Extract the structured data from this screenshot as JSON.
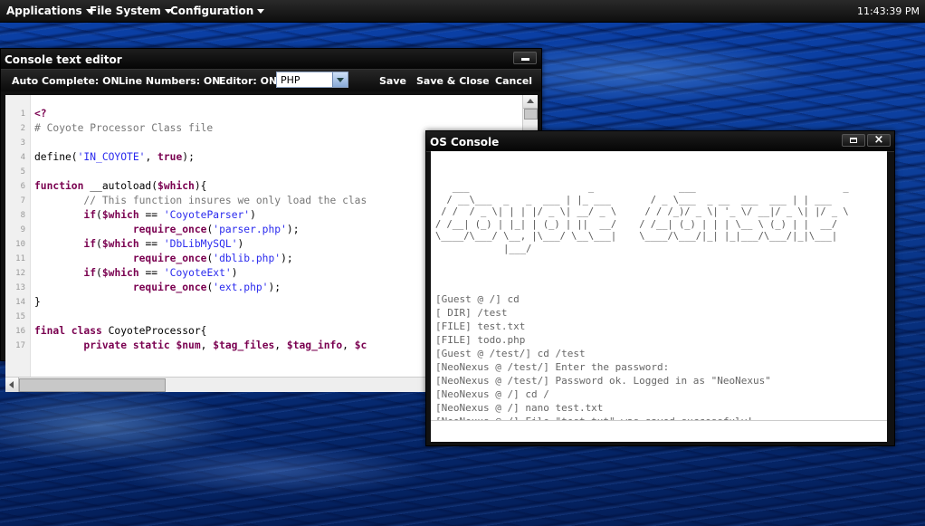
{
  "topbar": {
    "menus": [
      {
        "label": "Applications"
      },
      {
        "label": "File System"
      },
      {
        "label": "Configuration"
      }
    ],
    "clock": "11:43:39 PM"
  },
  "editor": {
    "title": "Console text editor",
    "auto_complete": "Auto Complete: ON",
    "line_numbers": "Line Numbers: ON",
    "editor_mode": "Editor: ON",
    "language": "PHP",
    "save": "Save",
    "save_close": "Save & Close",
    "cancel": "Cancel",
    "lines": [
      {
        "n": "1",
        "segs": [
          {
            "c": "kw",
            "t": "<?"
          }
        ]
      },
      {
        "n": "2",
        "segs": [
          {
            "c": "cm",
            "t": "# Coyote Processor Class file"
          }
        ]
      },
      {
        "n": "3",
        "segs": []
      },
      {
        "n": "4",
        "segs": [
          {
            "c": "fn",
            "t": "define("
          },
          {
            "c": "st",
            "t": "'IN_COYOTE'"
          },
          {
            "c": "fn",
            "t": ", "
          },
          {
            "c": "kw",
            "t": "true"
          },
          {
            "c": "fn",
            "t": ");"
          }
        ]
      },
      {
        "n": "5",
        "segs": []
      },
      {
        "n": "6",
        "segs": [
          {
            "c": "kw",
            "t": "function"
          },
          {
            "c": "fn",
            "t": " __autoload("
          },
          {
            "c": "vr",
            "t": "$which"
          },
          {
            "c": "fn",
            "t": "){"
          }
        ]
      },
      {
        "n": "7",
        "segs": [
          {
            "c": "cm",
            "t": "        // This function insures we only load the clas"
          }
        ]
      },
      {
        "n": "8",
        "segs": [
          {
            "c": "fn",
            "t": "        "
          },
          {
            "c": "kw",
            "t": "if"
          },
          {
            "c": "fn",
            "t": "("
          },
          {
            "c": "vr",
            "t": "$which"
          },
          {
            "c": "fn",
            "t": " == "
          },
          {
            "c": "st",
            "t": "'CoyoteParser'"
          },
          {
            "c": "fn",
            "t": ")"
          }
        ]
      },
      {
        "n": "9",
        "segs": [
          {
            "c": "fn",
            "t": "                "
          },
          {
            "c": "kw",
            "t": "require_once"
          },
          {
            "c": "fn",
            "t": "("
          },
          {
            "c": "st",
            "t": "'parser.php'"
          },
          {
            "c": "fn",
            "t": ");"
          }
        ]
      },
      {
        "n": "10",
        "segs": [
          {
            "c": "fn",
            "t": "        "
          },
          {
            "c": "kw",
            "t": "if"
          },
          {
            "c": "fn",
            "t": "("
          },
          {
            "c": "vr",
            "t": "$which"
          },
          {
            "c": "fn",
            "t": " == "
          },
          {
            "c": "st",
            "t": "'DbLibMySQL'"
          },
          {
            "c": "fn",
            "t": ")"
          }
        ]
      },
      {
        "n": "11",
        "segs": [
          {
            "c": "fn",
            "t": "                "
          },
          {
            "c": "kw",
            "t": "require_once"
          },
          {
            "c": "fn",
            "t": "("
          },
          {
            "c": "st",
            "t": "'dblib.php'"
          },
          {
            "c": "fn",
            "t": ");"
          }
        ]
      },
      {
        "n": "12",
        "segs": [
          {
            "c": "fn",
            "t": "        "
          },
          {
            "c": "kw",
            "t": "if"
          },
          {
            "c": "fn",
            "t": "("
          },
          {
            "c": "vr",
            "t": "$which"
          },
          {
            "c": "fn",
            "t": " == "
          },
          {
            "c": "st",
            "t": "'CoyoteExt'"
          },
          {
            "c": "fn",
            "t": ")"
          }
        ]
      },
      {
        "n": "13",
        "segs": [
          {
            "c": "fn",
            "t": "                "
          },
          {
            "c": "kw",
            "t": "require_once"
          },
          {
            "c": "fn",
            "t": "("
          },
          {
            "c": "st",
            "t": "'ext.php'"
          },
          {
            "c": "fn",
            "t": ");"
          }
        ]
      },
      {
        "n": "14",
        "segs": [
          {
            "c": "fn",
            "t": "}"
          }
        ]
      },
      {
        "n": "15",
        "segs": []
      },
      {
        "n": "16",
        "segs": [
          {
            "c": "kw",
            "t": "final class"
          },
          {
            "c": "fn",
            "t": " CoyoteProcessor{"
          }
        ]
      },
      {
        "n": "17",
        "segs": [
          {
            "c": "fn",
            "t": "        "
          },
          {
            "c": "kw",
            "t": "private static"
          },
          {
            "c": "fn",
            "t": " "
          },
          {
            "c": "vr",
            "t": "$num"
          },
          {
            "c": "fn",
            "t": ", "
          },
          {
            "c": "vr",
            "t": "$tag_files"
          },
          {
            "c": "fn",
            "t": ", "
          },
          {
            "c": "vr",
            "t": "$tag_info"
          },
          {
            "c": "fn",
            "t": ", "
          },
          {
            "c": "vr",
            "t": "$c"
          }
        ]
      }
    ]
  },
  "console": {
    "title": "OS Console",
    "ascii_art": "   ___                     _               ___                          _\n  / __\\___  _   _  ___ | |_ ___       / _ \\___  _ __  ___  ___ | | ___\n / /  / _ \\| | | |/ _ \\| __/ _ \\     / / /_)/ _ \\| '_ \\/ __|/ _ \\| |/ _ \\\n/ /__| (_) | |_| | (_) | ||  __/    / /__| (_) | | | \\__ \\ (_) | |  __/\n\\____/\\___/ \\__, |\\___/ \\__\\___|    \\____/\\___/|_| |_|___/\\___/|_|\\___|\n            |___/",
    "lines": [
      "[Guest @ /] cd",
      "[ DIR] /test",
      "[FILE] test.txt",
      "[FILE] todo.php",
      "[Guest @ /test/] cd /test",
      "[NeoNexus @ /test/] Enter the password:",
      "[NeoNexus @ /test/] Password ok. Logged in as \"NeoNexus\"",
      "[NeoNexus @ /] cd /",
      "[NeoNexus @ /] nano test.txt",
      "[NeoNexus @ /] File \"test.txt\" was saved successfuly!"
    ],
    "input_value": ""
  }
}
